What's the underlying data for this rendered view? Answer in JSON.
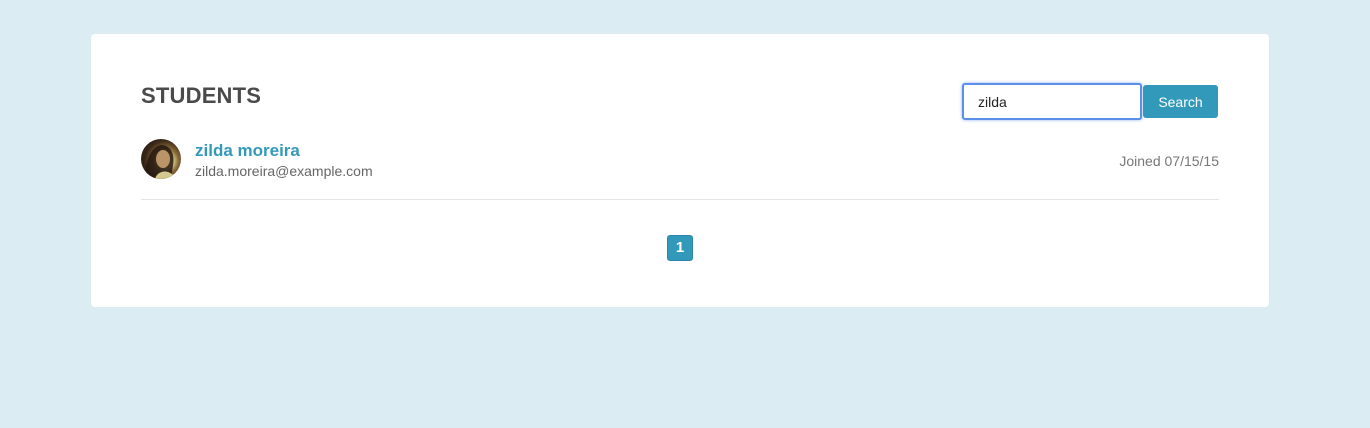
{
  "header": {
    "title": "STUDENTS"
  },
  "search": {
    "value": "zilda",
    "button_label": "Search"
  },
  "students": [
    {
      "name": "zilda moreira",
      "email": "zilda.moreira@example.com",
      "joined": "Joined 07/15/15"
    }
  ],
  "pagination": {
    "pages": [
      "1"
    ],
    "current": "1"
  },
  "colors": {
    "background": "#dcecf3",
    "accent": "#3399bb",
    "title": "#4a4a4a"
  }
}
